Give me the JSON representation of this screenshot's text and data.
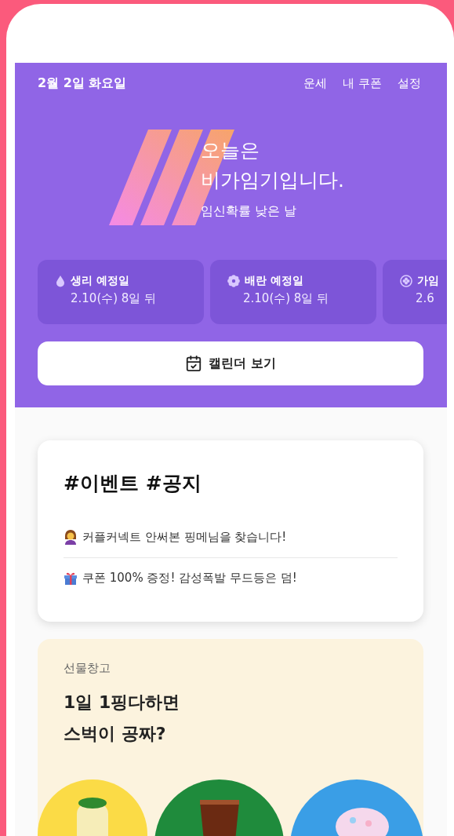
{
  "header": {
    "date": "2월 2일 화요일",
    "nav": [
      "운세",
      "내 쿠폰",
      "설정"
    ]
  },
  "hero": {
    "title_lines": [
      "오늘은",
      "비가임기입니다."
    ],
    "subtitle": "임신확률 낮은 날"
  },
  "cycle_cards": [
    {
      "kind": "period",
      "label": "생리 예정일",
      "value": "2.10(수) 8일 뒤"
    },
    {
      "kind": "ovulation",
      "label": "배란 예정일",
      "value": "2.10(수) 8일 뒤"
    },
    {
      "kind": "fertile",
      "label": "가임",
      "value": "2.6"
    }
  ],
  "calendar_button": {
    "label": "캘린더 보기"
  },
  "notice_card": {
    "title": "#이벤트 #공지",
    "items": [
      {
        "kind": "person",
        "text": "커플커넥트 안써본 핑메님을 찾습니다!"
      },
      {
        "kind": "gift",
        "text": "쿠폰 100% 증정! 감성폭발 무드등은 덤!"
      }
    ]
  },
  "gift_card": {
    "label": "선물창고",
    "title_lines": [
      "1일 1핑다하면",
      "스벅이 공짜?"
    ],
    "products": [
      {
        "kind": "picture"
      },
      {
        "kind": "picture"
      },
      {
        "kind": "picture"
      }
    ]
  }
}
